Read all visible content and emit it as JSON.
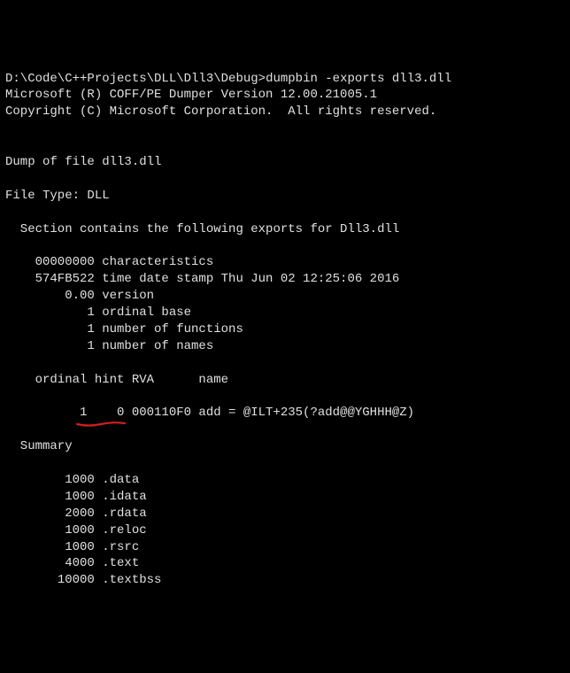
{
  "prompt": {
    "path": "D:\\Code\\C++Projects\\DLL\\Dll3\\Debug>",
    "cmd": "dumpbin -exports dll3.dll"
  },
  "header": {
    "line1": "Microsoft (R) COFF/PE Dumper Version 12.00.21005.1",
    "line2": "Copyright (C) Microsoft Corporation.  All rights reserved."
  },
  "dumpof": "Dump of file dll3.dll",
  "filetype": "File Type: DLL",
  "section_header": "  Section contains the following exports for Dll3.dll",
  "details": {
    "characteristics": "    00000000 characteristics",
    "timedate": "    574FB522 time date stamp Thu Jun 02 12:25:06 2016",
    "version": "        0.00 version",
    "ordinal_base": "           1 ordinal base",
    "nfunctions": "           1 number of functions",
    "nnames": "           1 number of names"
  },
  "table_header": "    ordinal hint RVA      name",
  "export_row": "          1    0 000110F0 add = @ILT+235(?add@@YGHHH@Z)",
  "summary_label": "  Summary",
  "summary": {
    "data": "        1000 .data",
    "idata": "        1000 .idata",
    "rdata": "        2000 .rdata",
    "reloc": "        1000 .reloc",
    "rsrc": "        1000 .rsrc",
    "text": "        4000 .text",
    "textbss": "       10000 .textbss"
  }
}
